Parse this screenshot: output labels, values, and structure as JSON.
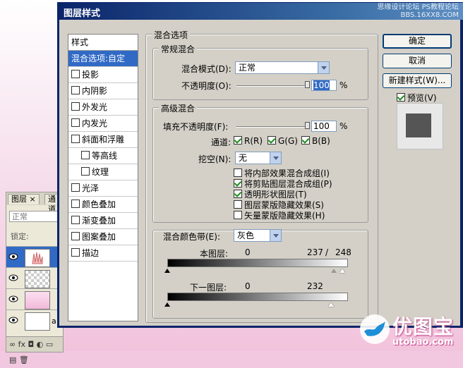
{
  "background": {
    "layers_tab": "图层",
    "layers_tab_close": "×",
    "channels_tab": "通道",
    "blend_mode": "正常",
    "lock_label": "锁定:",
    "layer_tag": "a",
    "footer_icons": "∞ fx ◘ ◐ ▭ ▤ 🗑"
  },
  "dialog": {
    "title": "图层样式",
    "watermark_line1": "思缘设计论坛  PS教程论坛",
    "watermark_line2": "BBS.16XX8.COM"
  },
  "styles": {
    "header": "样式",
    "items": [
      {
        "label": "混合选项:自定",
        "checkbox": false,
        "selected": true,
        "sub": false
      },
      {
        "label": "投影",
        "checkbox": true,
        "checked": false,
        "sub": false
      },
      {
        "label": "内阴影",
        "checkbox": true,
        "checked": false,
        "sub": false
      },
      {
        "label": "外发光",
        "checkbox": true,
        "checked": false,
        "sub": false
      },
      {
        "label": "内发光",
        "checkbox": true,
        "checked": false,
        "sub": false
      },
      {
        "label": "斜面和浮雕",
        "checkbox": true,
        "checked": false,
        "sub": false
      },
      {
        "label": "等高线",
        "checkbox": true,
        "checked": false,
        "sub": true
      },
      {
        "label": "纹理",
        "checkbox": true,
        "checked": false,
        "sub": true
      },
      {
        "label": "光泽",
        "checkbox": true,
        "checked": false,
        "sub": false
      },
      {
        "label": "颜色叠加",
        "checkbox": true,
        "checked": false,
        "sub": false
      },
      {
        "label": "渐变叠加",
        "checkbox": true,
        "checked": false,
        "sub": false
      },
      {
        "label": "图案叠加",
        "checkbox": true,
        "checked": false,
        "sub": false
      },
      {
        "label": "描边",
        "checkbox": true,
        "checked": false,
        "sub": false
      }
    ]
  },
  "blending": {
    "section_title": "混合选项",
    "general": {
      "title": "常规混合",
      "mode_label": "混合模式(D):",
      "mode_value": "正常",
      "opacity_label": "不透明度(O):",
      "opacity_value": "100",
      "opacity_level": 100,
      "percent": "%"
    },
    "advanced": {
      "title": "高级混合",
      "fill_label": "填充不透明度(F):",
      "fill_value": "100",
      "fill_level": 100,
      "percent": "%",
      "channels_label": "通道:",
      "channel_r": "R(R)",
      "channel_g": "G(G)",
      "channel_b": "B(B)",
      "knockout_label": "挖空(N):",
      "knockout_value": "无",
      "options": [
        {
          "label": "将内部效果混合成组(I)",
          "checked": false
        },
        {
          "label": "将剪贴图层混合成组(P)",
          "checked": true
        },
        {
          "label": "透明形状图层(T)",
          "checked": true
        },
        {
          "label": "图层蒙版隐藏效果(S)",
          "checked": false
        },
        {
          "label": "矢量蒙版隐藏效果(H)",
          "checked": false
        }
      ]
    },
    "blend_if": {
      "label": "混合颜色带(E):",
      "value": "灰色",
      "this_layer_label": "本图层:",
      "this_low": "0",
      "this_high": "237",
      "this_sep": "/",
      "this_high2": "248",
      "under_layer_label": "下一图层:",
      "under_low": "0",
      "under_high": "232"
    }
  },
  "buttons": {
    "ok": "确定",
    "cancel": "取消",
    "new_style": "新建样式(W)...",
    "preview_label": "预览(V)",
    "preview_checked": true
  },
  "logo": {
    "name": "优图宝",
    "url": "utobao.com"
  }
}
